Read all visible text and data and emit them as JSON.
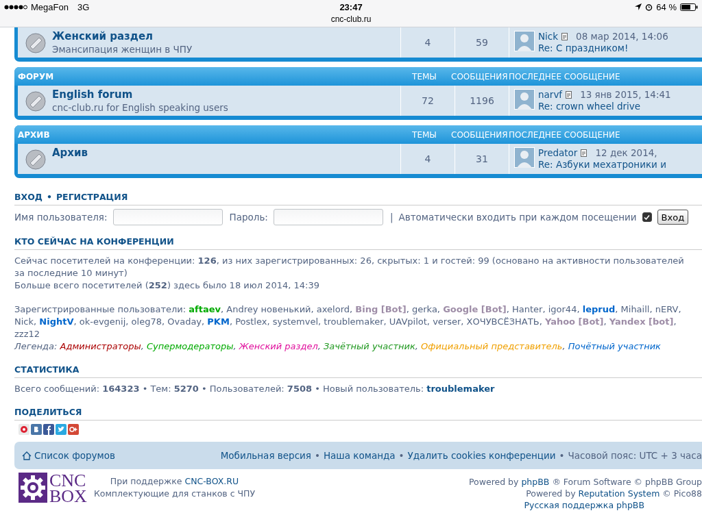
{
  "status_bar": {
    "carrier": "MegaFon",
    "network": "3G",
    "time": "23:47",
    "battery": "64 %",
    "url": "cnc-club.ru"
  },
  "categories": [
    {
      "forum": {
        "title": "Женский раздел",
        "description": "Эмансипация женщин в ЧПУ",
        "topics": "4",
        "posts": "59",
        "last_post": {
          "author": "Nick",
          "date": "08 мар 2014, 14:06",
          "subject": "Re: С праздником!"
        }
      }
    },
    {
      "header": {
        "title": "ФОРУМ",
        "topics": "ТЕМЫ",
        "posts": "СООБЩЕНИЯ",
        "last_post": "ПОСЛЕДНЕЕ СООБЩЕНИЕ"
      },
      "forum": {
        "title": "English forum",
        "description": "cnc-club.ru for English speaking users",
        "topics": "72",
        "posts": "1196",
        "last_post": {
          "author": "narvf",
          "date": "13 янв 2015, 14:41",
          "subject": "Re: crown wheel drive"
        }
      }
    },
    {
      "header": {
        "title": "АРХИВ",
        "topics": "ТЕМЫ",
        "posts": "СООБЩЕНИЯ",
        "last_post": "ПОСЛЕДНЕЕ СООБЩЕНИЕ"
      },
      "forum": {
        "title": "Архив",
        "topics": "4",
        "posts": "31",
        "last_post": {
          "author": "Predator",
          "date": "12 дек 2014,",
          "subject": "Re: Азбуки мехатроники и"
        }
      }
    }
  ],
  "login": {
    "login_link": "ВХОД",
    "bullet": "•",
    "register_link": "РЕГИСТРАЦИЯ",
    "username_label": "Имя пользователя:",
    "password_label": "Пароль:",
    "separator": "|",
    "autologin_label": "Автоматически входить при каждом посещении",
    "autologin_checked": true,
    "button": "Вход"
  },
  "who_is_online": {
    "heading": "КТО СЕЙЧАС НА КОНФЕРЕНЦИИ",
    "online_text": "Сейчас посетителей на конференции: **126**, из них зарегистрированных: 26, скрытых: 1 и гостей: 99 (основано на активности пользователей за последние 10 минут)",
    "record_text": "Больше всего посетителей (**252**) здесь было 18 июл 2014, 14:39",
    "users_label": "Зарегистрированные пользователи:",
    "separator": ",",
    "users": [
      {
        "name": "aftaev",
        "color": "#00aa00"
      },
      {
        "name": "Andrey новенький"
      },
      {
        "name": "axelord"
      },
      {
        "name": "Bing [Bot]",
        "color": "#9e8da7"
      },
      {
        "name": "gerka"
      },
      {
        "name": "Google [Bot]",
        "color": "#9e8da7"
      },
      {
        "name": "Hanter"
      },
      {
        "name": "igor44"
      },
      {
        "name": "leprud",
        "color": "#0066cc"
      },
      {
        "name": "Mihaill"
      },
      {
        "name": "nERV"
      },
      {
        "name": "Nick"
      },
      {
        "name": "NightV",
        "color": "#0066cc"
      },
      {
        "name": "ok-evgenij"
      },
      {
        "name": "oleg78"
      },
      {
        "name": "Ovaday"
      },
      {
        "name": "PKM",
        "color": "#0066cc"
      },
      {
        "name": "Postlex"
      },
      {
        "name": "systemvel"
      },
      {
        "name": "troublemaker"
      },
      {
        "name": "UAVpilot"
      },
      {
        "name": "verser"
      },
      {
        "name": "ХОЧУВСЁЗНАТЬ"
      },
      {
        "name": "Yahoo [Bot]",
        "color": "#9e8da7"
      },
      {
        "name": "Yandex [bot]",
        "color": "#9e8da7"
      },
      {
        "name": "zzz12"
      }
    ],
    "legend_label": "Легенда:",
    "legend": [
      {
        "name": "Администраторы",
        "color": "#aa0000"
      },
      {
        "name": "Супермодераторы",
        "color": "#00aa00"
      },
      {
        "name": "Женский раздел",
        "color": "#e0119d"
      },
      {
        "name": "Зачётный участник",
        "color": "#229922"
      },
      {
        "name": "Официальный представитель",
        "color": "#f0a000"
      },
      {
        "name": "Почётный участник",
        "color": "#0066cc"
      }
    ]
  },
  "statistics": {
    "heading": "СТАТИСТИКА",
    "text": "Всего сообщений: **164323** • Тем: **5270** • Пользователей: **7508** • Новый пользователь:",
    "new_user": "troublemaker"
  },
  "share": {
    "heading": "ПОДЕЛИТЬСЯ"
  },
  "footer_nav": {
    "home": "Список форумов",
    "bullet": "•",
    "links": [
      "Мобильная версия",
      "Наша команда",
      "Удалить cookies конференции"
    ],
    "timezone": "Часовой пояс: UTC + 3 часа"
  },
  "credits": {
    "logo": [
      "CNC",
      "BOX"
    ],
    "sponsor_prefix": "При поддержке",
    "sponsor_link": "CNC-BOX.RU",
    "tagline": "Комплектующие для станков с ЧПУ",
    "powered": [
      {
        "prefix": "Powered by",
        "link": "phpBB",
        "suffix": "® Forum Software © phpBB Group"
      },
      {
        "prefix": "Powered by",
        "link": "Reputation System",
        "suffix": "© Pico88"
      },
      {
        "link": "Русская поддержка phpBB"
      }
    ]
  }
}
